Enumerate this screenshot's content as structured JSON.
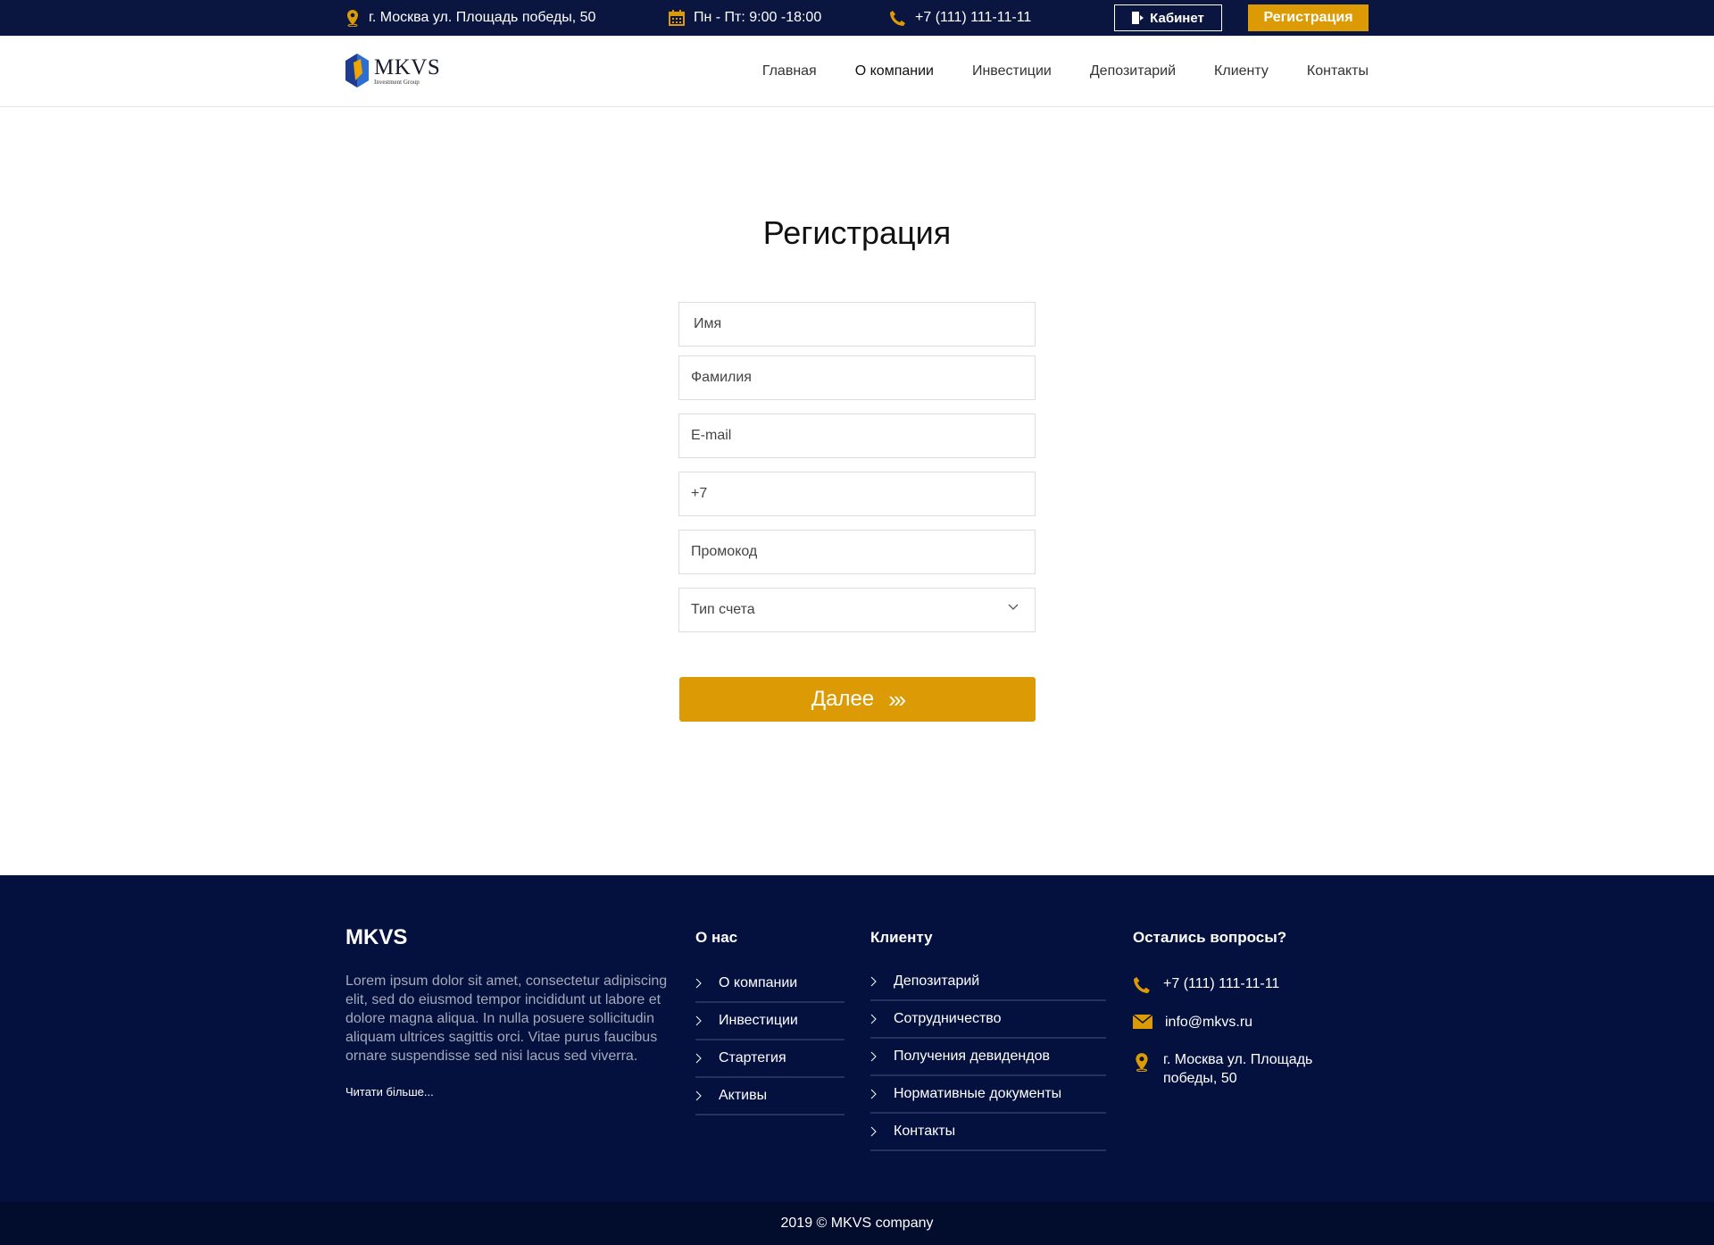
{
  "topbar": {
    "address": "г. Москва ул. Площадь победы, 50",
    "hours": "Пн - Пт: 9:00 -18:00",
    "phone": "+7  (111) 111-11-11",
    "cabinet_label": "Кабинет",
    "register_label": "Регистрация"
  },
  "header": {
    "logo_name": "MKVS",
    "logo_sub": "Investment Group",
    "nav": [
      "Главная",
      "О компании",
      "Инвестиции",
      "Депозитарий",
      "Клиенту",
      "Контакты"
    ]
  },
  "form": {
    "title": "Регистрация",
    "name_placeholder": "Имя",
    "surname_placeholder": "Фамилия",
    "email_placeholder": "E-mail",
    "phone_value": "+7",
    "promo_placeholder": "Промокод",
    "account_type_label": "Тип счета",
    "next_label": "Далее",
    "next_arrows": "›››"
  },
  "footer": {
    "brand": "MKVS",
    "text": "Lorem ipsum dolor sit amet, consectetur adipiscing elit, sed do eiusmod tempor incididunt ut labore et dolore magna aliqua. In nulla posuere sollicitudin aliquam ultrices sagittis orci. Vitae purus faucibus ornare suspendisse sed nisi lacus sed viverra.",
    "read_more": "Читати більше...",
    "about_title": "О нас",
    "about_items": [
      "О компании",
      "Инвестиции",
      "Стартегия",
      "Активы"
    ],
    "client_title": "Клиенту",
    "client_items": [
      "Депозитарий",
      "Сотрудничество",
      "Получения девидендов",
      "Нормативные документы",
      "Контакты"
    ],
    "questions_title": "Остались вопросы?",
    "contact_phone": "+7  (111) 111-11-11",
    "contact_email": "info@mkvs.ru",
    "contact_address": "г. Москва ул. Площадь победы, 50",
    "copyright": "2019 © MKVS company"
  },
  "colors": {
    "navy": "#0b1640",
    "footer_bg": "#04113e",
    "accent": "#dc9b04"
  }
}
